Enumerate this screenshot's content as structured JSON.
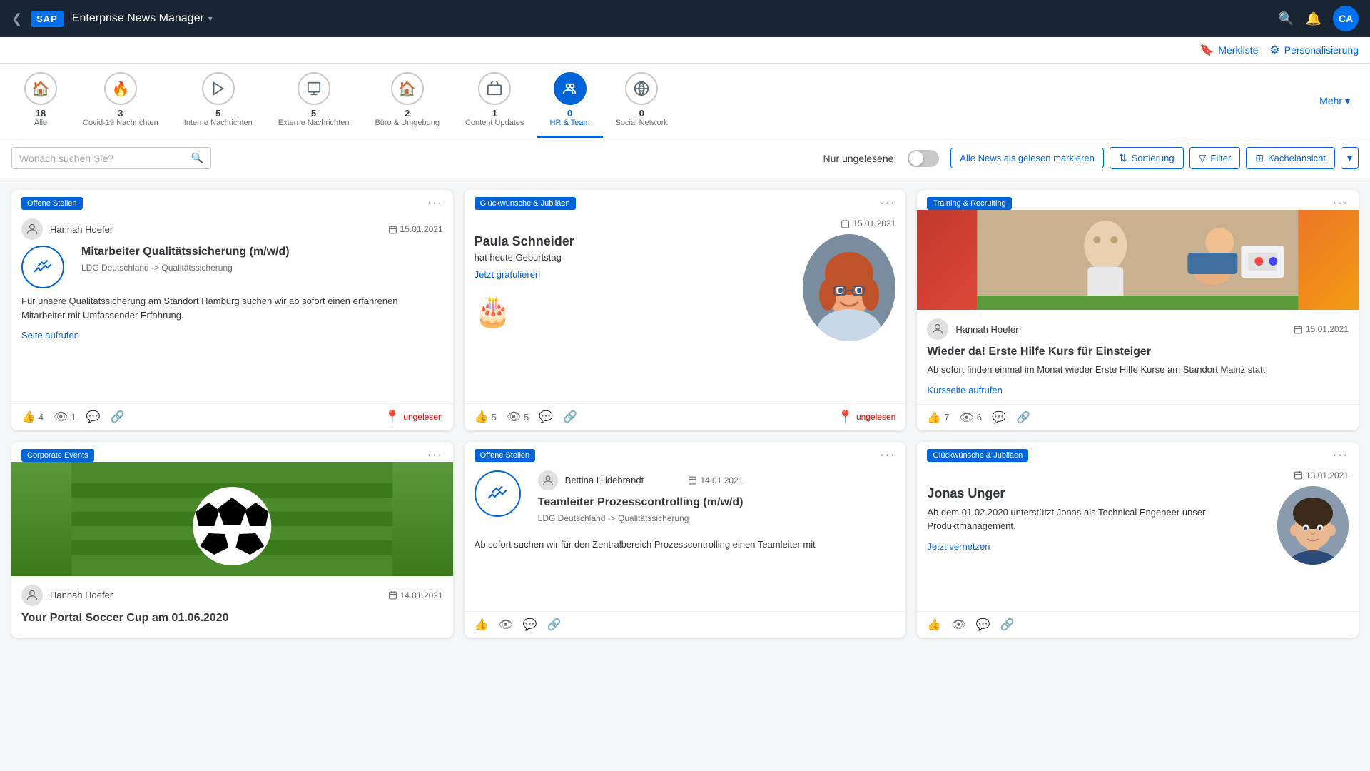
{
  "topnav": {
    "back_icon": "❮",
    "sap_logo": "SAP",
    "app_title": "Enterprise News Manager",
    "chevron": "▾",
    "search_icon": "🔍",
    "notification_icon": "🔔",
    "avatar_label": "CA"
  },
  "toolbar": {
    "bookmark_icon": "🔖",
    "bookmark_label": "Merkliste",
    "settings_icon": "⚙",
    "settings_label": "Personalisierung"
  },
  "categories": [
    {
      "id": "alle",
      "icon": "🏠",
      "count": "18",
      "label": "Alle",
      "active": false
    },
    {
      "id": "covid",
      "icon": "🔥",
      "count": "3",
      "label": "Covid-19 Nachrichten",
      "active": false
    },
    {
      "id": "interne",
      "icon": "➤",
      "count": "5",
      "label": "Interne Nachrichten",
      "active": false
    },
    {
      "id": "externe",
      "icon": "📄",
      "count": "5",
      "label": "Externe Nachrichten",
      "active": false
    },
    {
      "id": "buero",
      "icon": "🏠",
      "count": "2",
      "label": "Büro & Umgebung",
      "active": false
    },
    {
      "id": "content",
      "icon": "📦",
      "count": "1",
      "label": "Content Updates",
      "active": false
    },
    {
      "id": "hr",
      "icon": "👥",
      "count": "0",
      "label": "HR & Team",
      "active": true
    },
    {
      "id": "social",
      "icon": "◎",
      "count": "0",
      "label": "Social Network",
      "active": false
    }
  ],
  "more_label": "Mehr",
  "searchbar": {
    "placeholder": "Wonach suchen Sie?",
    "unread_label": "Nur ungelesene:",
    "mark_read_btn": "Alle News als gelesen markieren",
    "sort_btn": "Sortierung",
    "filter_btn": "Filter",
    "view_btn": "Kachelansicht"
  },
  "cards": [
    {
      "id": "card1",
      "tag": "Offene Stellen",
      "author": "Hannah Hoefer",
      "date": "15.01.2021",
      "title": "Mitarbeiter Qualitätssicherung (m/w/d)",
      "subtitle": "LDG Deutschland -> Qualitätssicherung",
      "text": "Für unsere Qualitätssicherung am Standort Hamburg suchen wir ab sofort einen erfahrenen Mitarbeiter mit Umfassender Erfahrung.",
      "link": "Seite aufrufen",
      "likes": "4",
      "views": "1",
      "type": "handshake",
      "unread": true,
      "unread_label": "ungelesen"
    },
    {
      "id": "card2",
      "tag": "Glückwünsche & Jubiläen",
      "date": "15.01.2021",
      "birthday_name": "Paula Schneider",
      "birthday_desc": "hat heute Geburtstag",
      "birthday_link": "Jetzt gratulieren",
      "likes": "5",
      "views": "5",
      "type": "birthday",
      "unread": true,
      "unread_label": "ungelesen"
    },
    {
      "id": "card3",
      "tag": "Training & Recruiting",
      "author": "Hannah Hoefer",
      "date": "15.01.2021",
      "title": "Wieder da! Erste Hilfe Kurs für Einsteiger",
      "text": "Ab sofort finden einmal im Monat wieder Erste Hilfe Kurse am Standort Mainz statt",
      "link": "Kursseite aufrufen",
      "likes": "7",
      "views": "6",
      "type": "medical_image",
      "unread": false
    },
    {
      "id": "card4",
      "tag": "Corporate Events",
      "author": "Hannah Hoefer",
      "date": "14.01.2021",
      "title": "Your Portal Soccer Cup am 01.06.2020",
      "type": "soccer_image",
      "unread": false
    },
    {
      "id": "card5",
      "tag": "Offene Stellen",
      "author": "Bettina Hildebrandt",
      "date": "14.01.2021",
      "title": "Teamleiter Prozesscontrolling (m/w/d)",
      "subtitle": "LDG Deutschland -> Qualitätssicherung",
      "text": "Ab sofort suchen wir für den Zentralbereich Prozesscontrolling einen Teamleiter mit",
      "type": "handshake",
      "unread": false
    },
    {
      "id": "card6",
      "tag": "Glückwünsche & Jubiläen",
      "date": "13.01.2021",
      "birthday_name": "Jonas Unger",
      "birthday_desc": "Ab dem 01.02.2020 unterstützt Jonas als Technical Engeneer unser Produktmanagement.",
      "birthday_link": "Jetzt vernetzen",
      "type": "person_card",
      "unread": false
    }
  ]
}
